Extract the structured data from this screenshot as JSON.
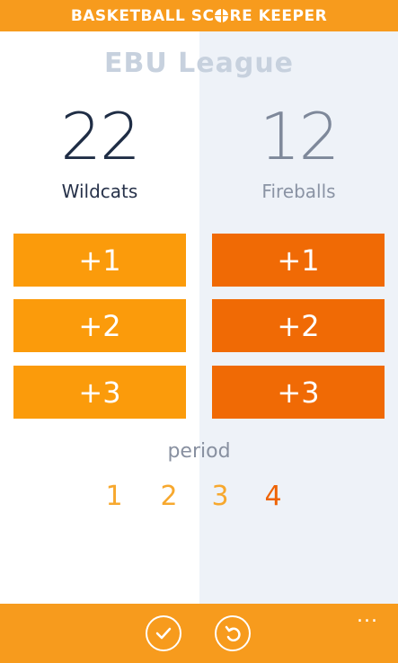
{
  "header": {
    "title_part1": "BASKETBALL SC",
    "title_part2": "RE KEEPER"
  },
  "league": "EBU League",
  "teams": [
    {
      "score": "22",
      "name": "Wildcats"
    },
    {
      "score": "12",
      "name": "Fireballs"
    }
  ],
  "buttons": {
    "plus1": "+1",
    "plus2": "+2",
    "plus3": "+3"
  },
  "period": {
    "label": "period",
    "options": [
      "1",
      "2",
      "3",
      "4"
    ],
    "current": "4"
  },
  "colors": {
    "accent": "#f79b1d",
    "home_button": "#fb9b0b",
    "away_button": "#f06a05",
    "period_inactive": "#f7a82e",
    "period_active": "#ee6305"
  },
  "appbar": {
    "icons": [
      "check-icon",
      "undo-icon"
    ],
    "more": "..."
  }
}
